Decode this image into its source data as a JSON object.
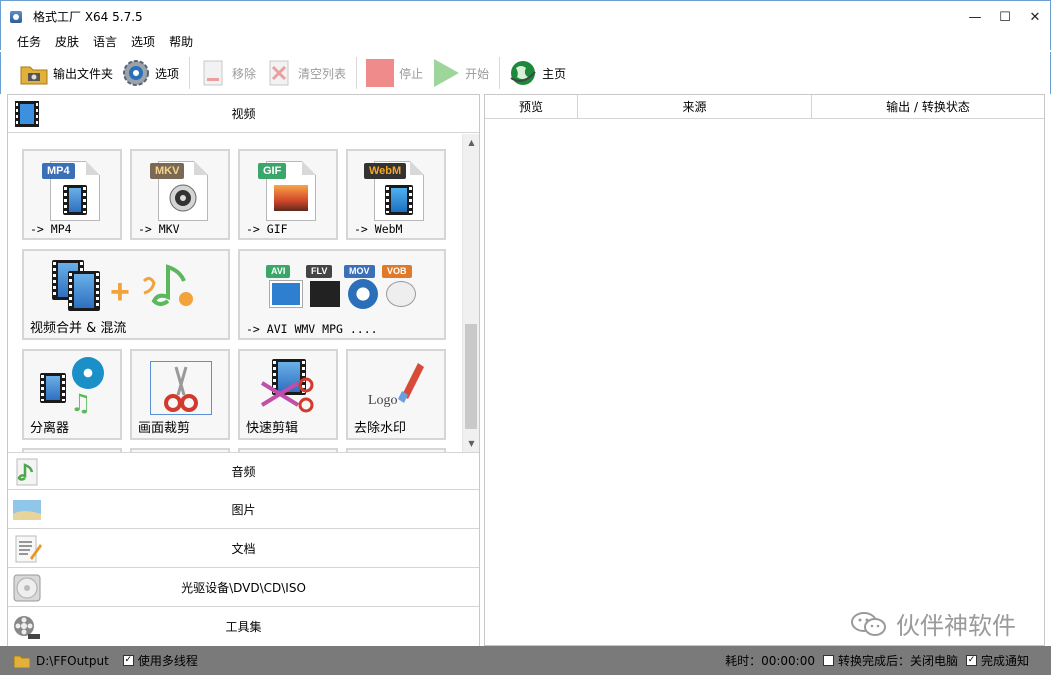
{
  "window": {
    "title": "格式工厂 X64 5.7.5",
    "minimize": "—",
    "maximize": "☐",
    "close": "✕"
  },
  "menu": [
    "任务",
    "皮肤",
    "语言",
    "选项",
    "帮助"
  ],
  "toolbar": {
    "output_folder": "输出文件夹",
    "options": "选项",
    "remove": "移除",
    "clear_list": "清空列表",
    "stop": "停止",
    "start": "开始",
    "home": "主页"
  },
  "categories": {
    "video": "视频",
    "audio": "音频",
    "picture": "图片",
    "document": "文档",
    "disc": "光驱设备\\DVD\\CD\\ISO",
    "tools": "工具集"
  },
  "video_tiles": {
    "mp4": {
      "tag": "MP4",
      "label": "-> MP4"
    },
    "mkv": {
      "tag": "MKV",
      "label": "-> MKV"
    },
    "gif": {
      "tag": "GIF",
      "label": "-> GIF"
    },
    "webm": {
      "tag": "WebM",
      "label": "-> WebM"
    },
    "merge": {
      "label": "视频合并 & 混流"
    },
    "others": {
      "tags": [
        "AVI",
        "FLV",
        "MOV",
        "VOB"
      ],
      "label": "-> AVI WMV MPG ...."
    },
    "splitter": {
      "label": "分离器"
    },
    "crop": {
      "label": "画面裁剪"
    },
    "quick_clip": {
      "label": "快速剪辑"
    },
    "remove_watermark": {
      "label": "去除水印",
      "logo_text": "Logo"
    }
  },
  "task_list": {
    "columns": [
      "预览",
      "来源",
      "输出 / 转换状态"
    ]
  },
  "watermark": {
    "text": "伙伴神软件"
  },
  "status": {
    "output_path": "D:\\FFOutput",
    "multithread": "使用多线程",
    "elapsed": "耗时：00:00:00",
    "after_done": "转换完成后：关闭电脑",
    "notify": "完成通知"
  },
  "colors": {
    "mp4_tag": "#3b6fb7",
    "mkv_tag": "#7a6a55",
    "gif_tag": "#3aa66a",
    "webm_tag": "#333333",
    "stop": "#f08b8b",
    "start": "#9ed59a",
    "statusbar": "#7a7a7a"
  }
}
